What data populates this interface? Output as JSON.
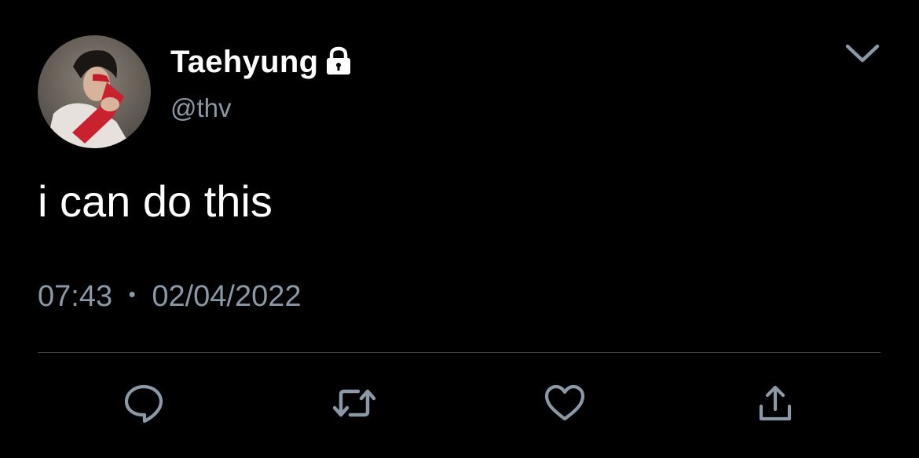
{
  "tweet": {
    "display_name": "Taehyung",
    "handle": "@thv",
    "text": "i can do this",
    "time": "07:43",
    "separator": "•",
    "date": "02/04/2022",
    "protected": true
  },
  "icons": {
    "lock": "lock-icon",
    "caret": "chevron-down-icon",
    "reply": "reply-icon",
    "retweet": "retweet-icon",
    "like": "heart-icon",
    "share": "share-icon"
  },
  "colors": {
    "background": "#000000",
    "text_primary": "#ffffff",
    "text_secondary": "#8b98a5",
    "divider": "#3a3f44",
    "icon": "#8b98a5"
  }
}
